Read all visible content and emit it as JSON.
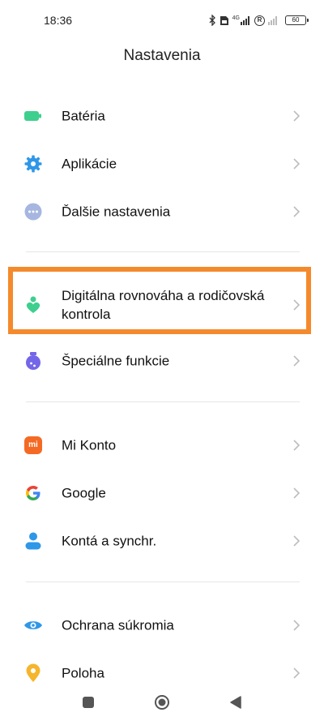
{
  "status_bar": {
    "time": "18:36",
    "network_label": "4G",
    "roaming_label": "R",
    "battery_level": "60",
    "icons": [
      "bluetooth-icon",
      "sim-card-icon",
      "signal-4g-icon",
      "roaming-icon",
      "signal-icon",
      "battery-icon"
    ]
  },
  "header": {
    "title": "Nastavenia"
  },
  "settings": {
    "items": [
      {
        "label": "Batéria",
        "icon": "battery-icon",
        "color": "#3ecf8e"
      },
      {
        "label": "Aplikácie",
        "icon": "gear-icon",
        "color": "#2f97e8"
      },
      {
        "label": "Ďalšie nastavenia",
        "icon": "more-icon",
        "color": "#a7b6e0"
      },
      {
        "label": "Digitálna rovnováha a rodičovská kontrola",
        "icon": "digital-wellbeing-icon",
        "color": "#3ecf8e"
      },
      {
        "label": "Špeciálne funkcie",
        "icon": "special-features-icon",
        "color": "#7466e8"
      },
      {
        "label": "Mi Konto",
        "icon": "mi-account-icon",
        "color": "#f46a24"
      },
      {
        "label": "Google",
        "icon": "google-icon",
        "color": "#4285f4"
      },
      {
        "label": "Kontá a synchr.",
        "icon": "accounts-icon",
        "color": "#2f97e8"
      },
      {
        "label": "Ochrana súkromia",
        "icon": "privacy-eye-icon",
        "color": "#2f97e8"
      },
      {
        "label": "Poloha",
        "icon": "location-icon",
        "color": "#f5b52c"
      }
    ],
    "highlight_color": "#f58a2c",
    "mi_logo_text": "mi"
  },
  "navbar": {
    "icons": [
      "recent-apps-icon",
      "home-icon",
      "back-icon"
    ]
  }
}
